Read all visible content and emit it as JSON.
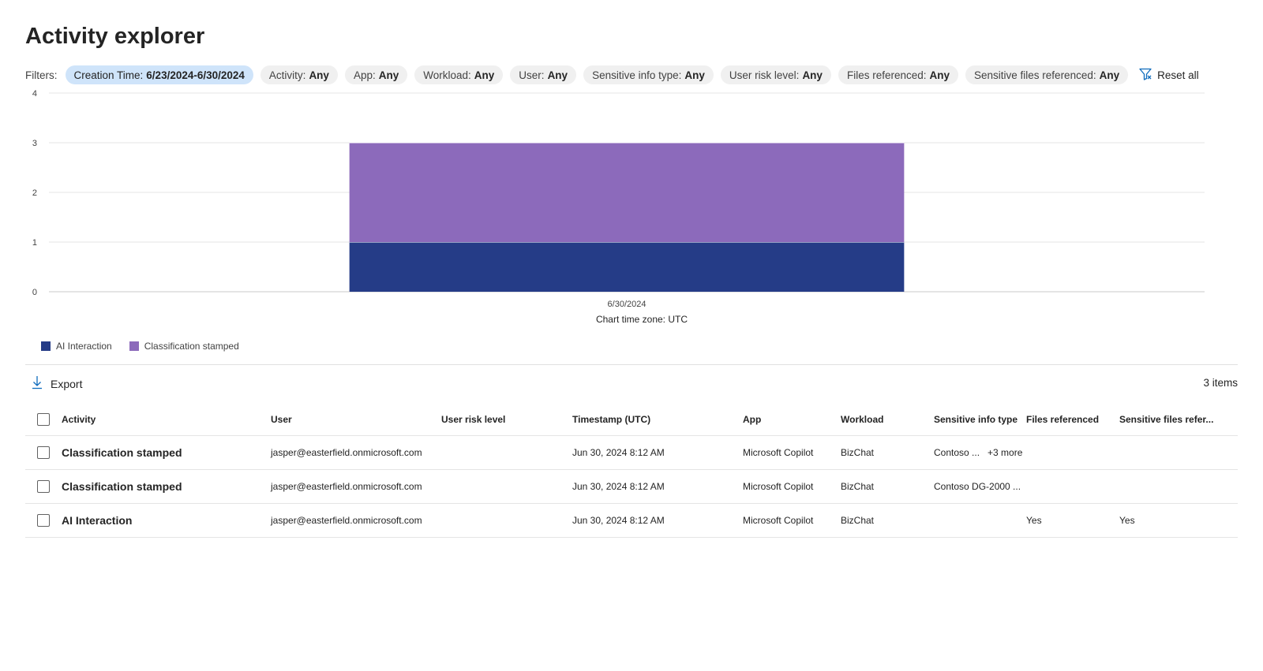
{
  "page_title": "Activity explorer",
  "filters": {
    "label": "Filters:",
    "pills": [
      {
        "name": "Creation Time:",
        "value": "6/23/2024-6/30/2024",
        "active": true
      },
      {
        "name": "Activity:",
        "value": "Any"
      },
      {
        "name": "App:",
        "value": "Any"
      },
      {
        "name": "Workload:",
        "value": "Any"
      },
      {
        "name": "User:",
        "value": "Any"
      },
      {
        "name": "Sensitive info type:",
        "value": "Any"
      },
      {
        "name": "User risk level:",
        "value": "Any"
      },
      {
        "name": "Files referenced:",
        "value": "Any"
      },
      {
        "name": "Sensitive files referenced:",
        "value": "Any"
      }
    ],
    "reset_label": "Reset all",
    "reset_icon": "filter-clear-icon"
  },
  "chart_data": {
    "type": "bar",
    "stacked": true,
    "categories": [
      "6/30/2024"
    ],
    "series": [
      {
        "name": "AI Interaction",
        "values": [
          1
        ],
        "color": "#253c87"
      },
      {
        "name": "Classification stamped",
        "values": [
          2
        ],
        "color": "#8c6abb"
      }
    ],
    "ylim": [
      0,
      4
    ],
    "yticks": [
      "0",
      "1",
      "2",
      "3",
      "4"
    ],
    "grid": true,
    "note": "Chart time zone: UTC",
    "legend_position": "bottom-left"
  },
  "toolbar": {
    "export_label": "Export",
    "export_icon": "download-icon",
    "items_count": "3 items"
  },
  "table": {
    "columns": [
      "Activity",
      "User",
      "User risk level",
      "Timestamp (UTC)",
      "App",
      "Workload",
      "Sensitive info type",
      "Files referenced",
      "Sensitive files refer..."
    ],
    "rows": [
      {
        "activity": "Classification stamped",
        "user": "jasper@easterfield.onmicrosoft.com",
        "risk": "",
        "timestamp": "Jun 30, 2024 8:12 AM",
        "app": "Microsoft Copilot",
        "workload": "BizChat",
        "sit": "Contoso ...",
        "sit_more": "+3 more",
        "files": "",
        "sensitive_files": ""
      },
      {
        "activity": "Classification stamped",
        "user": "jasper@easterfield.onmicrosoft.com",
        "risk": "",
        "timestamp": "Jun 30, 2024 8:12 AM",
        "app": "Microsoft Copilot",
        "workload": "BizChat",
        "sit": "Contoso DG-2000 ...",
        "sit_more": "",
        "files": "",
        "sensitive_files": ""
      },
      {
        "activity": "AI Interaction",
        "user": "jasper@easterfield.onmicrosoft.com",
        "risk": "",
        "timestamp": "Jun 30, 2024 8:12 AM",
        "app": "Microsoft Copilot",
        "workload": "BizChat",
        "sit": "",
        "sit_more": "",
        "files": "Yes",
        "sensitive_files": "Yes"
      }
    ]
  },
  "colors": {
    "active_pill": "#cfe4fa",
    "pill": "#f0f0f0",
    "accent": "#0f6cbd"
  }
}
